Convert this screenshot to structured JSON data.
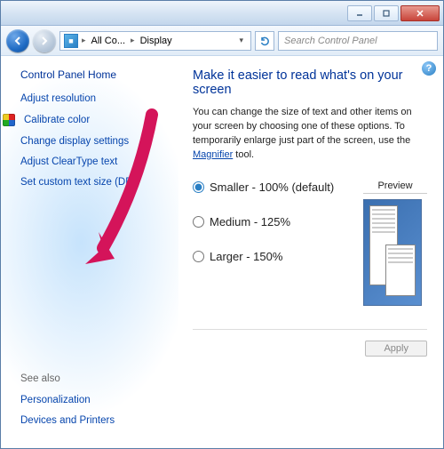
{
  "titlebar": {
    "minimize": "–",
    "maximize": "▢",
    "close": "✕"
  },
  "nav": {
    "crumb1": "All Co...",
    "crumb2": "Display",
    "search_placeholder": "Search Control Panel"
  },
  "sidebar": {
    "home": "Control Panel Home",
    "links": [
      "Adjust resolution",
      "Calibrate color",
      "Change display settings",
      "Adjust ClearType text",
      "Set custom text size (DPI)"
    ],
    "seealso_hdr": "See also",
    "seealso": [
      "Personalization",
      "Devices and Printers"
    ]
  },
  "main": {
    "heading": "Make it easier to read what's on your screen",
    "desc_pre": "You can change the size of text and other items on your screen by choosing one of these options. To temporarily enlarge just part of the screen, use the ",
    "desc_link": "Magnifier",
    "desc_post": " tool.",
    "options": [
      {
        "label": "Smaller - 100% (default)",
        "checked": true
      },
      {
        "label": "Medium - 125%",
        "checked": false
      },
      {
        "label": "Larger - 150%",
        "checked": false
      }
    ],
    "preview_hdr": "Preview",
    "apply": "Apply"
  },
  "help": "?"
}
